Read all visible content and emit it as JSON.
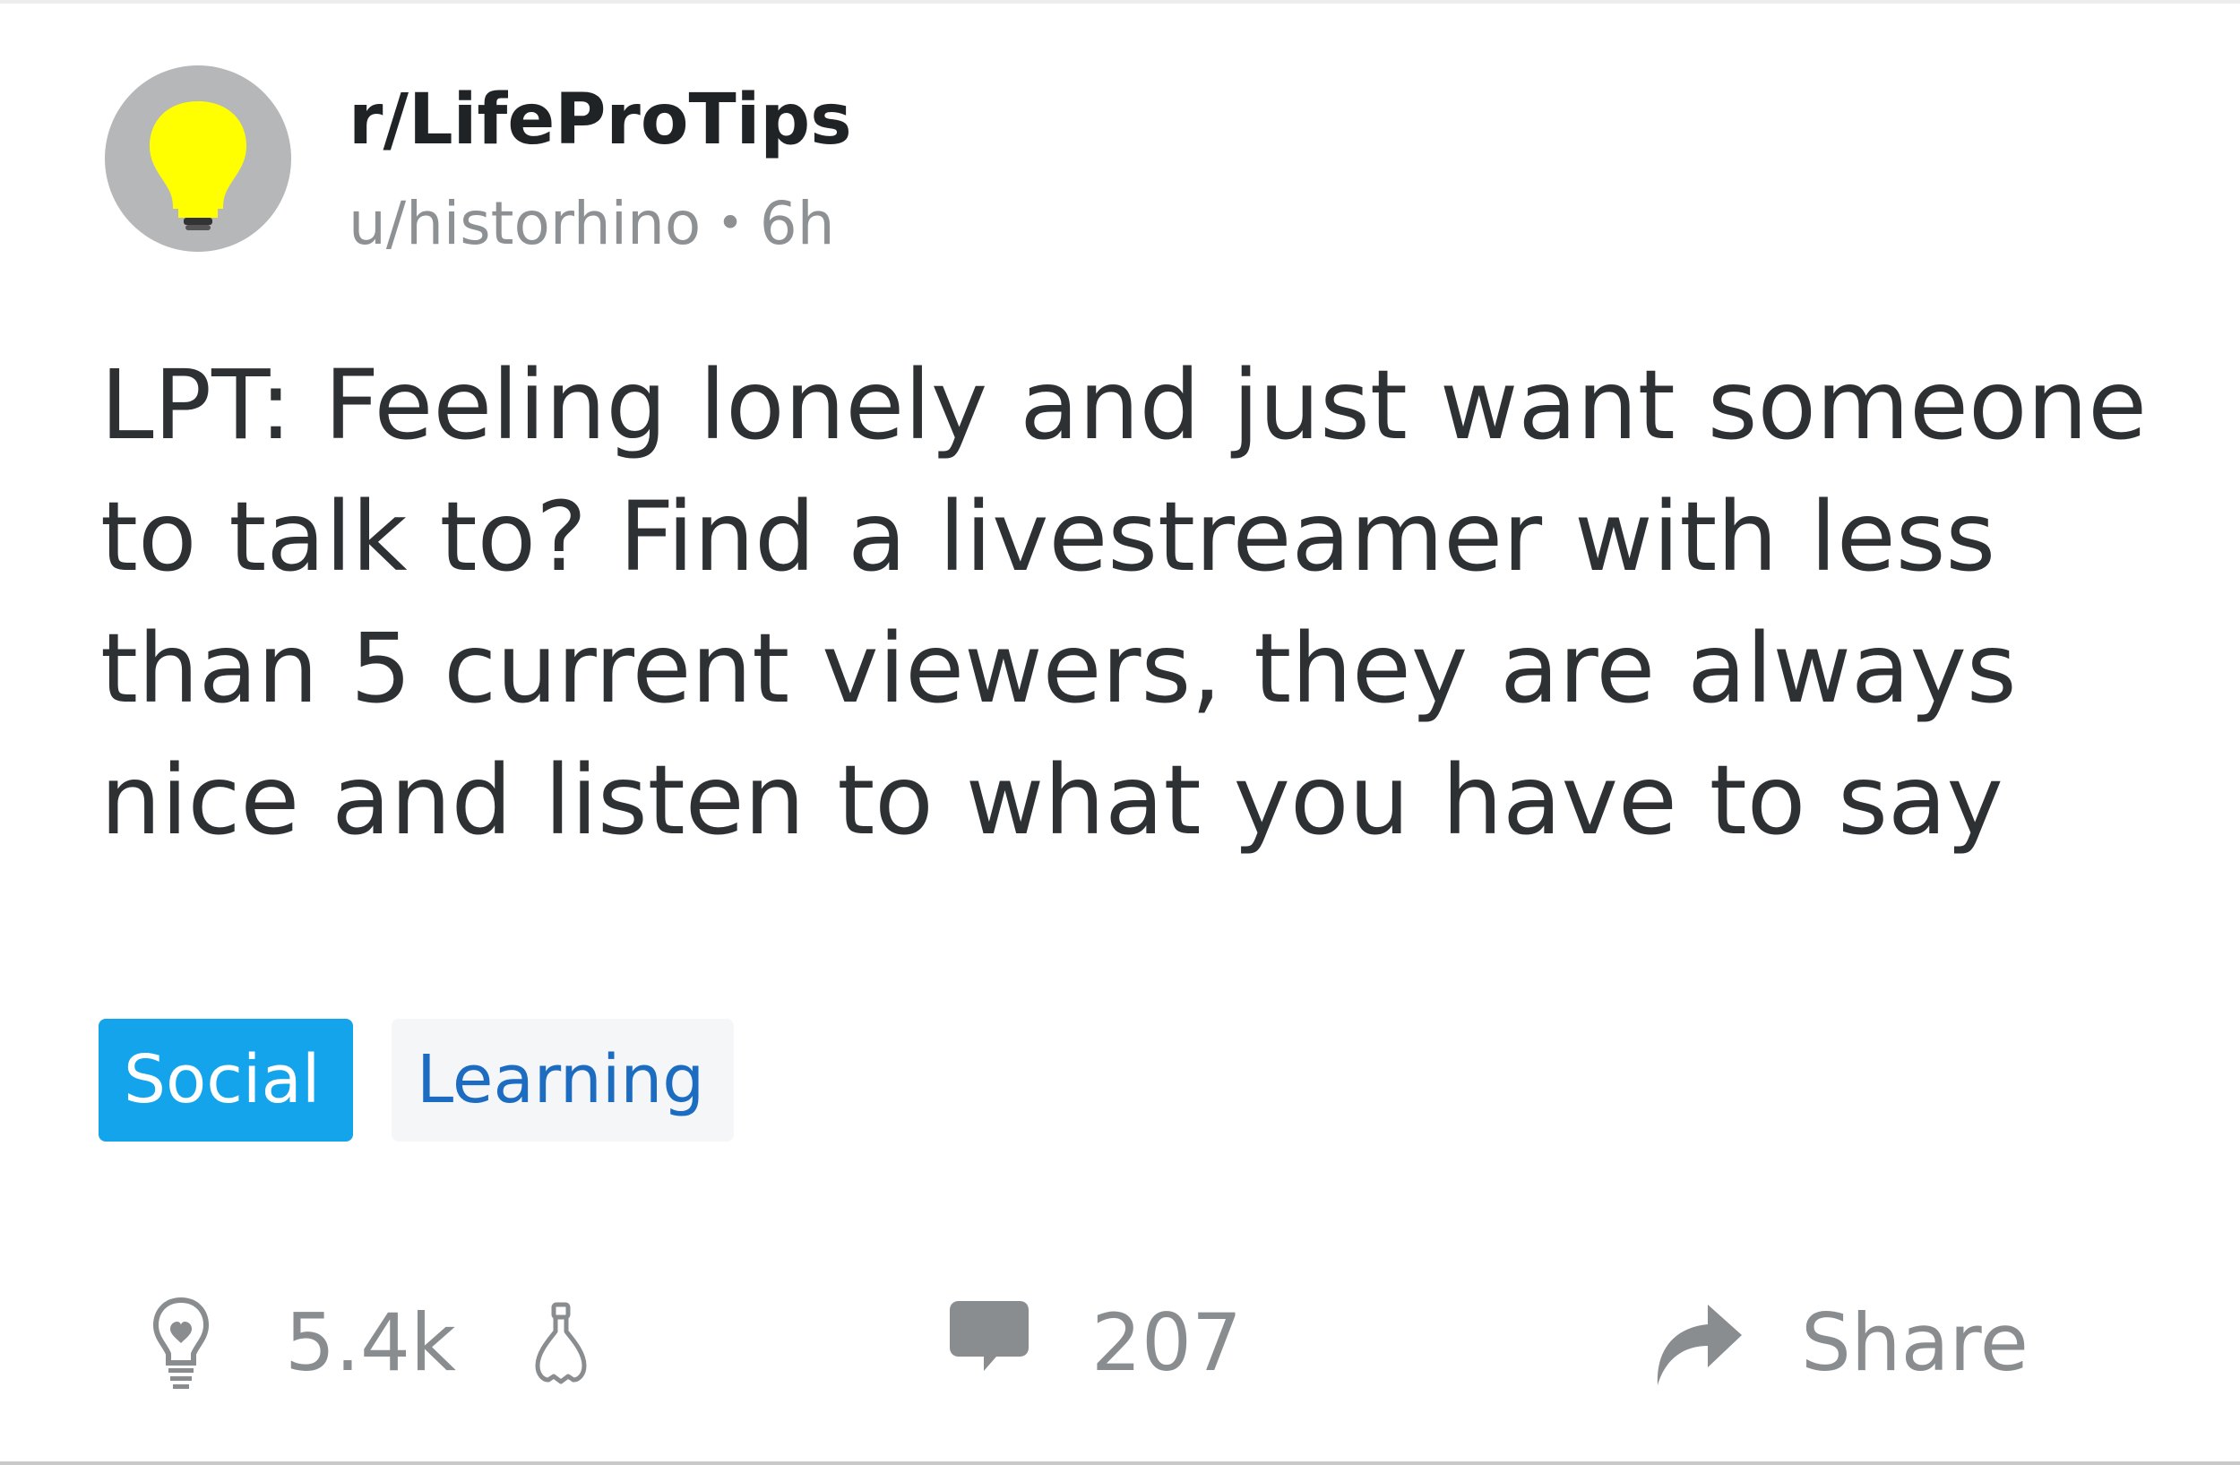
{
  "post": {
    "subreddit": "r/LifeProTips",
    "author": "u/historhino",
    "separator": "•",
    "age": "6h",
    "title": "LPT: Feeling lonely and just want someone to talk to? Find a livestreamer with less than 5 current viewers, they are always nice and listen to what you have to say",
    "flairs": [
      {
        "label": "Social",
        "bg": "#13a4eb",
        "fg": "#ffffff"
      },
      {
        "label": "Learning",
        "bg": "#f5f6f7",
        "fg": "#1c6cc2"
      }
    ]
  },
  "actions": {
    "upvote_icon": "lightbulb-upvote-icon",
    "vote_count": "5.4k",
    "downvote_icon": "lightbulb-downvote-icon",
    "comment_icon": "comment-bubble-icon",
    "comment_count": "207",
    "share_icon": "share-arrow-icon",
    "share_label": "Share"
  },
  "colors": {
    "avatar_bg": "#b6b7b9",
    "bulb": "#ffff00",
    "text": "#2e3134",
    "muted": "#8a8d8f"
  }
}
